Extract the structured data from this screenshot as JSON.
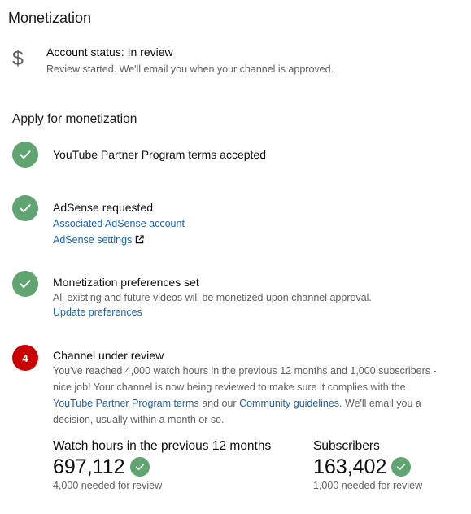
{
  "page": {
    "title": "Monetization"
  },
  "account_status": {
    "icon": "dollar-icon",
    "title": "Account status: In review",
    "subtitle": "Review started. We'll email you when your channel is approved."
  },
  "apply": {
    "title": "Apply for monetization",
    "steps": [
      {
        "status": "done",
        "icon": "check-icon",
        "title": "YouTube Partner Program terms accepted"
      },
      {
        "status": "done",
        "icon": "check-icon",
        "title": "AdSense requested",
        "links": [
          "Associated AdSense account",
          "AdSense settings"
        ]
      },
      {
        "status": "done",
        "icon": "check-icon",
        "title": "Monetization preferences set",
        "description": "All existing and future videos will be monetized upon channel approval.",
        "links": [
          "Update preferences"
        ]
      },
      {
        "status": "in-progress",
        "number": "4",
        "title": "Channel under review",
        "description_part1": "You've reached 4,000 watch hours in the previous 12 months and 1,000 subscribers - nice job! Your channel is now being reviewed to make sure it complies with the ",
        "link1": "YouTube Partner Program terms",
        "description_part2": " and our ",
        "link2": "Community guidelines",
        "description_part3": ". We'll email you a decision, usually within a month or so."
      }
    ]
  },
  "stats": {
    "watch_hours": {
      "label": "Watch hours in the previous 12 months",
      "value": "697,112",
      "note": "4,000 needed for review"
    },
    "subscribers": {
      "label": "Subscribers",
      "value": "163,402",
      "note": "1,000 needed for review"
    }
  },
  "colors": {
    "check_green": "#5fa471",
    "badge_red": "#cc0000",
    "link_blue": "#1c62b9",
    "secondary_text": "#606060"
  }
}
